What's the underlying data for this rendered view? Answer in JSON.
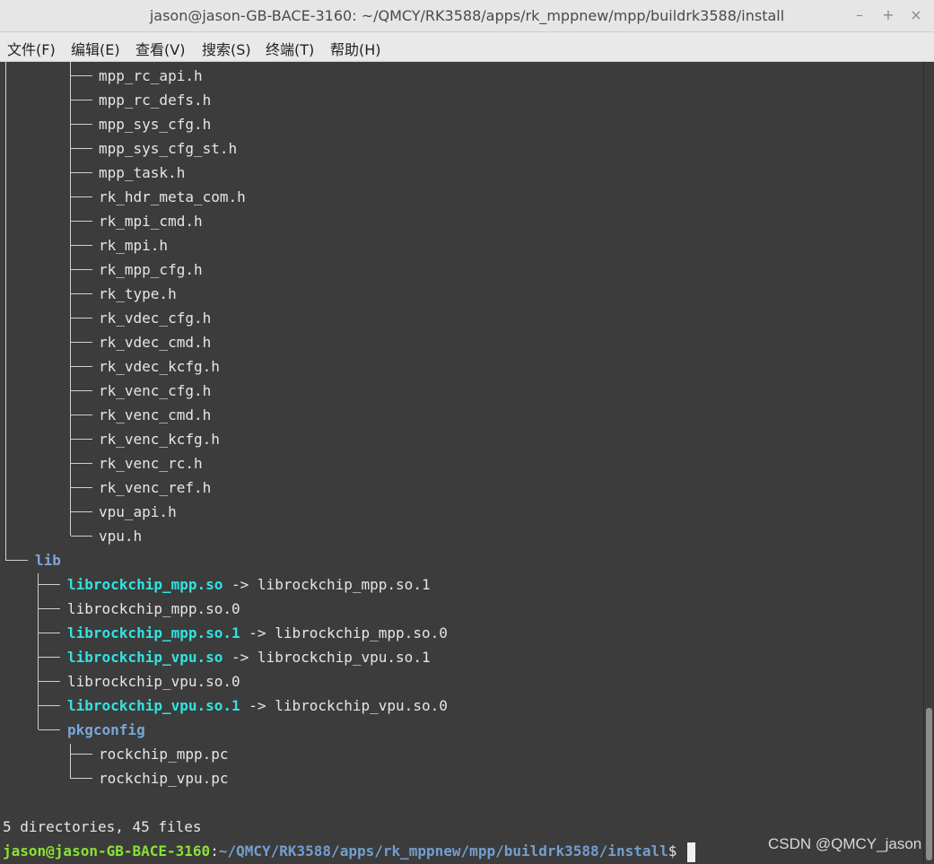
{
  "window": {
    "title": "jason@jason-GB-BACE-3160: ~/QMCY/RK3588/apps/rk_mppnew/mpp/buildrk3588/install",
    "buttons": {
      "minimize": "–",
      "maximize": "+",
      "close": "×"
    }
  },
  "menu": [
    "文件(F)",
    "编辑(E)",
    "查看(V)",
    "搜索(S)",
    "终端(T)",
    "帮助(H)"
  ],
  "tree": {
    "headers": [
      "mpp_rc_api.h",
      "mpp_rc_defs.h",
      "mpp_sys_cfg.h",
      "mpp_sys_cfg_st.h",
      "mpp_task.h",
      "rk_hdr_meta_com.h",
      "rk_mpi_cmd.h",
      "rk_mpi.h",
      "rk_mpp_cfg.h",
      "rk_type.h",
      "rk_vdec_cfg.h",
      "rk_vdec_cmd.h",
      "rk_vdec_kcfg.h",
      "rk_venc_cfg.h",
      "rk_venc_cmd.h",
      "rk_venc_kcfg.h",
      "rk_venc_rc.h",
      "rk_venc_ref.h",
      "vpu_api.h",
      "vpu.h"
    ],
    "lib_dir": "lib",
    "lib_entries": [
      {
        "name": "librockchip_mpp.so",
        "target": "libr​ockchip_mpp.so.1",
        "arrow": " -> "
      },
      {
        "name": "librockchip_mpp.so.0",
        "target": "",
        "arrow": ""
      },
      {
        "name": "librockchip_mpp.so.1",
        "target": "librockchip_mpp.so.0",
        "arrow": " -> "
      },
      {
        "name": "librockchip_vpu.so",
        "target": "librockchip_vpu.so.1",
        "arrow": " -> "
      },
      {
        "name": "librockchip_vpu.so.0",
        "target": "",
        "arrow": ""
      },
      {
        "name": "librockchip_vpu.so.1",
        "target": "librockchip_vpu.so.0",
        "arrow": " -> "
      }
    ],
    "pkgconfig_dir": "pkgconfig",
    "pkgconfig_files": [
      "rockchip_mpp.pc",
      "rockchip_vpu.pc"
    ]
  },
  "summary": "5 directories, 45 files",
  "prompt": {
    "user_host": "jason@jason-GB-BACE-3160",
    "colon": ":",
    "path": "~/QMCY/RK3588/apps/rk_mppnew/mpp/buildrk3588/install",
    "symbol": "$"
  },
  "watermark": "CSDN @QMCY_jason"
}
